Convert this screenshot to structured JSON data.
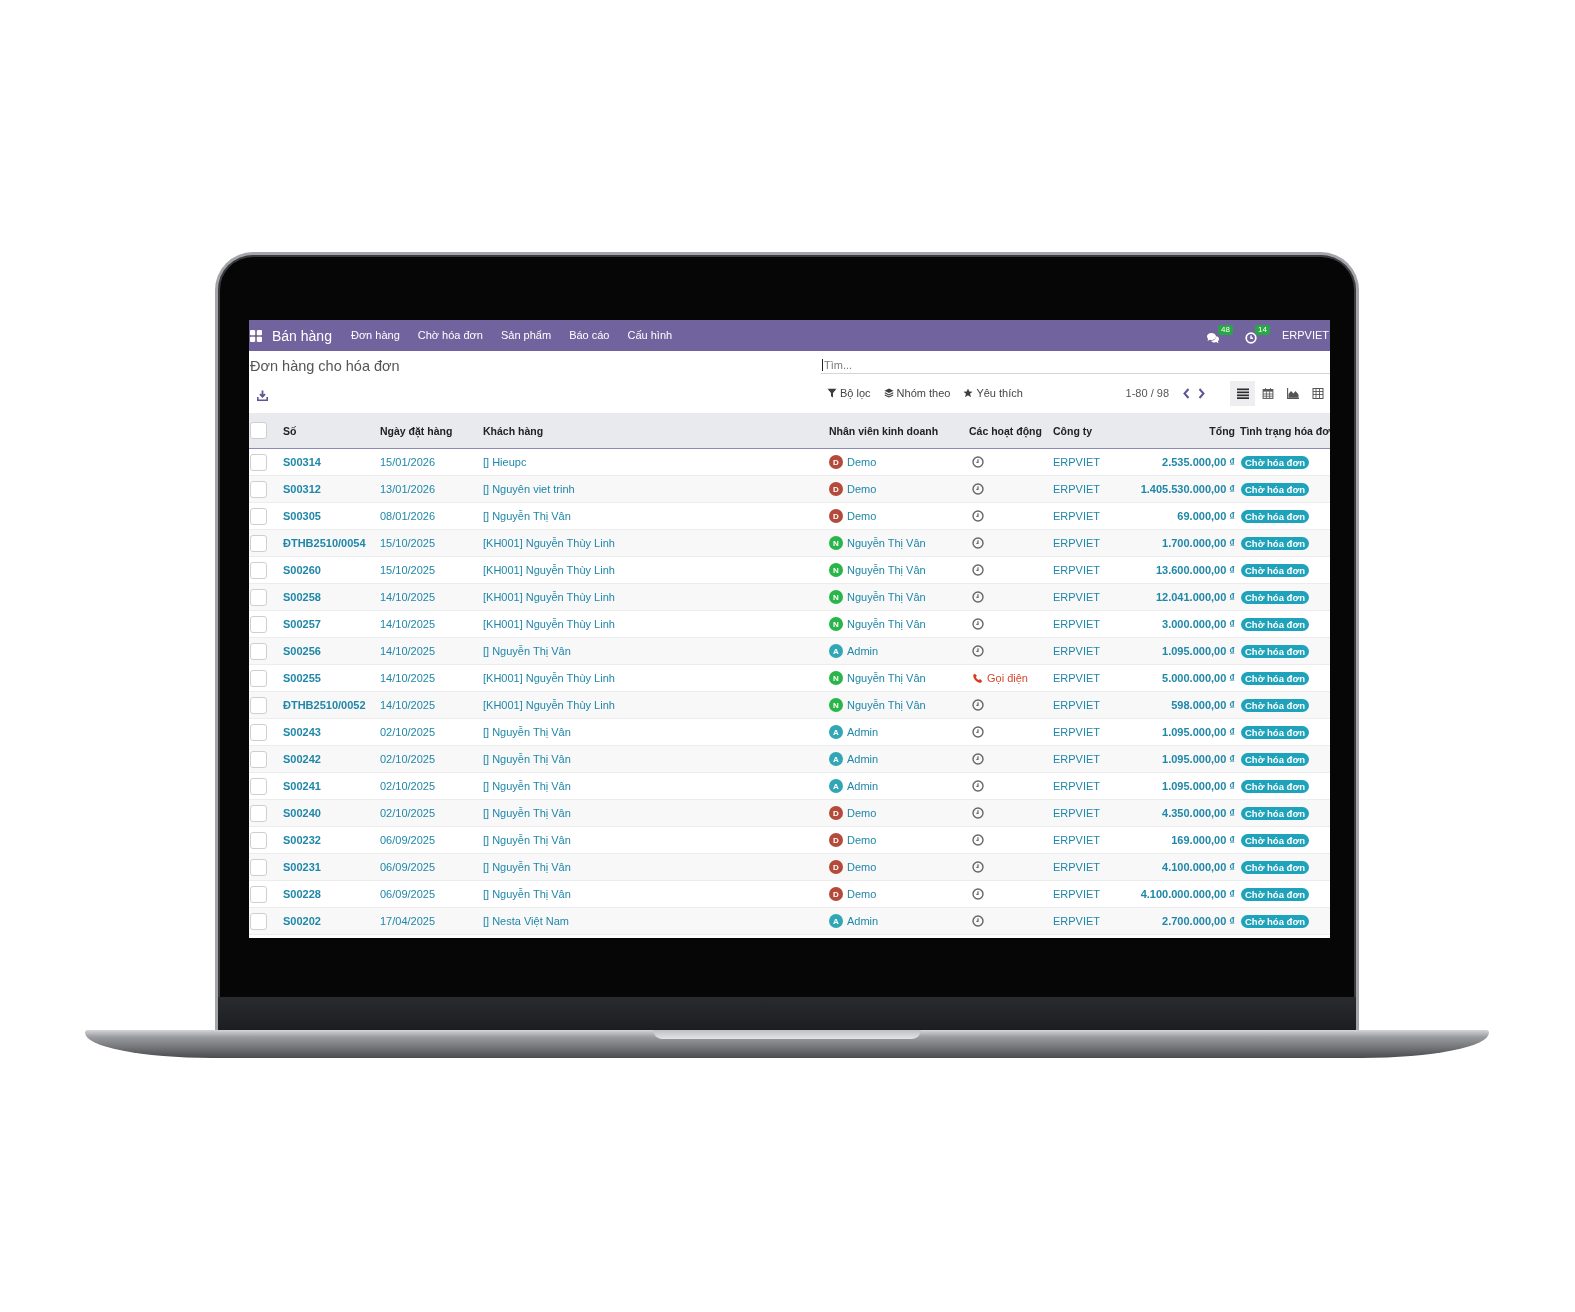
{
  "navbar": {
    "app_title": "Bán hàng",
    "menu": [
      "Đơn hàng",
      "Chờ hóa đơn",
      "Sản phẩm",
      "Báo cáo",
      "Cấu hình"
    ],
    "messages_count": "48",
    "activities_count": "14",
    "company": "ERPVIET"
  },
  "control_panel": {
    "title": "Đơn hàng cho hóa đơn",
    "search": {
      "placeholder": "Tìm...",
      "focused": true
    },
    "filters": [
      {
        "kind": "filter",
        "label": "Bộ lọc"
      },
      {
        "kind": "group",
        "label": "Nhóm theo"
      },
      {
        "kind": "favorite",
        "label": "Yêu thích"
      }
    ],
    "pager": "1-80 / 98",
    "views": [
      {
        "kind": "list",
        "selected": true
      },
      {
        "kind": "calendar",
        "selected": false
      },
      {
        "kind": "graph",
        "selected": false
      },
      {
        "kind": "pivot",
        "selected": false
      }
    ]
  },
  "table": {
    "select_all": {
      "checked": false
    },
    "columns": [
      "Số",
      "Ngày đặt hàng",
      "Khách hàng",
      "Nhân viên kinh doanh",
      "Các hoạt động",
      "Công ty",
      "Tổng",
      "Tình trạng hóa đơ"
    ],
    "rows": [
      {
        "checked": false,
        "number": "S00314",
        "date": "15/01/2026",
        "customer": "[] Hieupc",
        "salesperson": {
          "initial": "D",
          "name": "Demo",
          "color": "#b44a3a"
        },
        "activity": {
          "kind": "clock"
        },
        "company": "ERPVIET",
        "total": "2.535.000,00 ₫",
        "status": "Chờ hóa đơn"
      },
      {
        "checked": false,
        "number": "S00312",
        "date": "13/01/2026",
        "customer": "[] Nguyên viet trinh",
        "salesperson": {
          "initial": "D",
          "name": "Demo",
          "color": "#b44a3a"
        },
        "activity": {
          "kind": "clock"
        },
        "company": "ERPVIET",
        "total": "1.405.530.000,00 ₫",
        "status": "Chờ hóa đơn"
      },
      {
        "checked": false,
        "number": "S00305",
        "date": "08/01/2026",
        "customer": "[] Nguyễn Thị Vân",
        "salesperson": {
          "initial": "D",
          "name": "Demo",
          "color": "#b44a3a"
        },
        "activity": {
          "kind": "clock"
        },
        "company": "ERPVIET",
        "total": "69.000,00 ₫",
        "status": "Chờ hóa đơn"
      },
      {
        "checked": false,
        "number": "ĐTHB2510/0054",
        "date": "15/10/2025",
        "customer": "[KH001] Nguyễn Thùy Linh",
        "salesperson": {
          "initial": "N",
          "name": "Nguyễn Thị Vân",
          "color": "#2ab54a"
        },
        "activity": {
          "kind": "clock"
        },
        "company": "ERPVIET",
        "total": "1.700.000,00 ₫",
        "status": "Chờ hóa đơn"
      },
      {
        "checked": false,
        "number": "S00260",
        "date": "15/10/2025",
        "customer": "[KH001] Nguyễn Thùy Linh",
        "salesperson": {
          "initial": "N",
          "name": "Nguyễn Thị Vân",
          "color": "#2ab54a"
        },
        "activity": {
          "kind": "clock"
        },
        "company": "ERPVIET",
        "total": "13.600.000,00 ₫",
        "status": "Chờ hóa đơn"
      },
      {
        "checked": false,
        "number": "S00258",
        "date": "14/10/2025",
        "customer": "[KH001] Nguyễn Thùy Linh",
        "salesperson": {
          "initial": "N",
          "name": "Nguyễn Thị Vân",
          "color": "#2ab54a"
        },
        "activity": {
          "kind": "clock"
        },
        "company": "ERPVIET",
        "total": "12.041.000,00 ₫",
        "status": "Chờ hóa đơn"
      },
      {
        "checked": false,
        "number": "S00257",
        "date": "14/10/2025",
        "customer": "[KH001] Nguyễn Thùy Linh",
        "salesperson": {
          "initial": "N",
          "name": "Nguyễn Thị Vân",
          "color": "#2ab54a"
        },
        "activity": {
          "kind": "clock"
        },
        "company": "ERPVIET",
        "total": "3.000.000,00 ₫",
        "status": "Chờ hóa đơn"
      },
      {
        "checked": false,
        "number": "S00256",
        "date": "14/10/2025",
        "customer": "[] Nguyễn Thị Vân",
        "salesperson": {
          "initial": "A",
          "name": "Admin",
          "color": "#33a6b6"
        },
        "activity": {
          "kind": "clock"
        },
        "company": "ERPVIET",
        "total": "1.095.000,00 ₫",
        "status": "Chờ hóa đơn"
      },
      {
        "checked": false,
        "number": "S00255",
        "date": "14/10/2025",
        "customer": "[KH001] Nguyễn Thùy Linh",
        "salesperson": {
          "initial": "N",
          "name": "Nguyễn Thị Vân",
          "color": "#2ab54a"
        },
        "activity": {
          "kind": "call",
          "label": "Gọi điện"
        },
        "company": "ERPVIET",
        "total": "5.000.000,00 ₫",
        "status": "Chờ hóa đơn"
      },
      {
        "checked": false,
        "number": "ĐTHB2510/0052",
        "date": "14/10/2025",
        "customer": "[KH001] Nguyễn Thùy Linh",
        "salesperson": {
          "initial": "N",
          "name": "Nguyễn Thị Vân",
          "color": "#2ab54a"
        },
        "activity": {
          "kind": "clock"
        },
        "company": "ERPVIET",
        "total": "598.000,00 ₫",
        "status": "Chờ hóa đơn"
      },
      {
        "checked": false,
        "number": "S00243",
        "date": "02/10/2025",
        "customer": "[] Nguyễn Thị Vân",
        "salesperson": {
          "initial": "A",
          "name": "Admin",
          "color": "#33a6b6"
        },
        "activity": {
          "kind": "clock"
        },
        "company": "ERPVIET",
        "total": "1.095.000,00 ₫",
        "status": "Chờ hóa đơn"
      },
      {
        "checked": false,
        "number": "S00242",
        "date": "02/10/2025",
        "customer": "[] Nguyễn Thị Vân",
        "salesperson": {
          "initial": "A",
          "name": "Admin",
          "color": "#33a6b6"
        },
        "activity": {
          "kind": "clock"
        },
        "company": "ERPVIET",
        "total": "1.095.000,00 ₫",
        "status": "Chờ hóa đơn"
      },
      {
        "checked": false,
        "number": "S00241",
        "date": "02/10/2025",
        "customer": "[] Nguyễn Thị Vân",
        "salesperson": {
          "initial": "A",
          "name": "Admin",
          "color": "#33a6b6"
        },
        "activity": {
          "kind": "clock"
        },
        "company": "ERPVIET",
        "total": "1.095.000,00 ₫",
        "status": "Chờ hóa đơn"
      },
      {
        "checked": false,
        "number": "S00240",
        "date": "02/10/2025",
        "customer": "[] Nguyễn Thị Vân",
        "salesperson": {
          "initial": "D",
          "name": "Demo",
          "color": "#b44a3a"
        },
        "activity": {
          "kind": "clock"
        },
        "company": "ERPVIET",
        "total": "4.350.000,00 ₫",
        "status": "Chờ hóa đơn"
      },
      {
        "checked": false,
        "number": "S00232",
        "date": "06/09/2025",
        "customer": "[] Nguyễn Thị Vân",
        "salesperson": {
          "initial": "D",
          "name": "Demo",
          "color": "#b44a3a"
        },
        "activity": {
          "kind": "clock"
        },
        "company": "ERPVIET",
        "total": "169.000,00 ₫",
        "status": "Chờ hóa đơn"
      },
      {
        "checked": false,
        "number": "S00231",
        "date": "06/09/2025",
        "customer": "[] Nguyễn Thị Vân",
        "salesperson": {
          "initial": "D",
          "name": "Demo",
          "color": "#b44a3a"
        },
        "activity": {
          "kind": "clock"
        },
        "company": "ERPVIET",
        "total": "4.100.000,00 ₫",
        "status": "Chờ hóa đơn"
      },
      {
        "checked": false,
        "number": "S00228",
        "date": "06/09/2025",
        "customer": "[] Nguyễn Thị Vân",
        "salesperson": {
          "initial": "D",
          "name": "Demo",
          "color": "#b44a3a"
        },
        "activity": {
          "kind": "clock"
        },
        "company": "ERPVIET",
        "total": "4.100.000.000,00 ₫",
        "status": "Chờ hóa đơn"
      },
      {
        "checked": false,
        "number": "S00202",
        "date": "17/04/2025",
        "customer": "[] Nesta Việt Nam",
        "salesperson": {
          "initial": "A",
          "name": "Admin",
          "color": "#33a6b6"
        },
        "activity": {
          "kind": "clock"
        },
        "company": "ERPVIET",
        "total": "2.700.000,00 ₫",
        "status": "Chờ hóa đơn"
      }
    ]
  }
}
